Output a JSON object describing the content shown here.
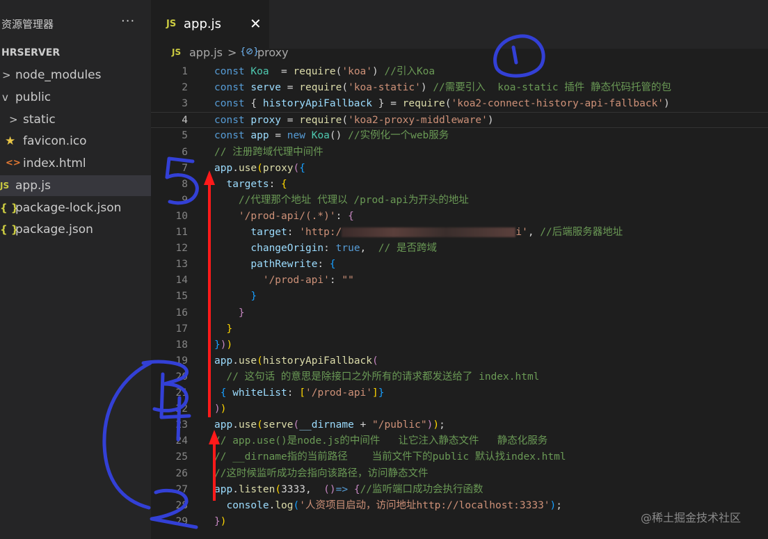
{
  "sidebar": {
    "title": "资源管理器",
    "more": "···",
    "section": "HRSERVER",
    "items": [
      {
        "label": "node_modules",
        "icon": "chevron-right-icon"
      },
      {
        "label": "public",
        "icon": "chevron-down-icon"
      },
      {
        "label": "static",
        "icon": "chevron-right-icon"
      },
      {
        "label": "favicon.ico",
        "icon": "star-icon"
      },
      {
        "label": "index.html",
        "icon": "html-icon"
      },
      {
        "label": "app.js",
        "icon": "js-icon"
      },
      {
        "label": "package-lock.json",
        "icon": "json-icon"
      },
      {
        "label": "package.json",
        "icon": "json-icon"
      }
    ]
  },
  "tab": {
    "badge": "JS",
    "label": "app.js",
    "close": "✕"
  },
  "breadcrumb": {
    "badge": "JS",
    "file": "app.js",
    "sep": ">",
    "symbol_icon": "{⊘}",
    "symbol": "proxy"
  },
  "editor": {
    "line_numbers": [
      "1",
      "2",
      "3",
      "4",
      "5",
      "6",
      "7",
      "8",
      "9",
      "10",
      "11",
      "12",
      "13",
      "14",
      "15",
      "16",
      "17",
      "18",
      "19",
      "20",
      "21",
      "22",
      "23",
      "24",
      "25",
      "26",
      "27",
      "28",
      "29"
    ],
    "code": [
      [
        {
          "t": "kw",
          "v": "const "
        },
        {
          "t": "cl",
          "v": "Koa"
        },
        {
          "t": "plain",
          "v": "  = "
        },
        {
          "t": "fn",
          "v": "require"
        },
        {
          "t": "plain",
          "v": "("
        },
        {
          "t": "st",
          "v": "'koa'"
        },
        {
          "t": "plain",
          "v": ") "
        },
        {
          "t": "cm",
          "v": "//引入Koa"
        }
      ],
      [
        {
          "t": "kw",
          "v": "const "
        },
        {
          "t": "vr",
          "v": "serve"
        },
        {
          "t": "plain",
          "v": " = "
        },
        {
          "t": "fn",
          "v": "require"
        },
        {
          "t": "plain",
          "v": "("
        },
        {
          "t": "st",
          "v": "'koa-static'"
        },
        {
          "t": "plain",
          "v": ") "
        },
        {
          "t": "cm",
          "v": "//需要引入  koa-static 插件 静态代码托管的包"
        }
      ],
      [
        {
          "t": "kw",
          "v": "const "
        },
        {
          "t": "plain",
          "v": "{ "
        },
        {
          "t": "vr",
          "v": "historyApiFallback"
        },
        {
          "t": "plain",
          "v": " } = "
        },
        {
          "t": "fn",
          "v": "require"
        },
        {
          "t": "plain",
          "v": "("
        },
        {
          "t": "st",
          "v": "'koa2-connect-history-api-fallback'"
        },
        {
          "t": "plain",
          "v": ")"
        }
      ],
      [
        {
          "t": "kw",
          "v": "const "
        },
        {
          "t": "vr",
          "v": "proxy"
        },
        {
          "t": "plain",
          "v": " = "
        },
        {
          "t": "fn",
          "v": "require"
        },
        {
          "t": "plain",
          "v": "("
        },
        {
          "t": "st",
          "v": "'koa2-proxy-middleware'"
        },
        {
          "t": "plain",
          "v": ")"
        }
      ],
      [
        {
          "t": "kw",
          "v": "const "
        },
        {
          "t": "vr",
          "v": "app"
        },
        {
          "t": "plain",
          "v": " = "
        },
        {
          "t": "kw",
          "v": "new "
        },
        {
          "t": "cl",
          "v": "Koa"
        },
        {
          "t": "plain",
          "v": "() "
        },
        {
          "t": "cm",
          "v": "//实例化一个web服务"
        }
      ],
      [
        {
          "t": "cm",
          "v": "// 注册跨域代理中间件"
        }
      ],
      [
        {
          "t": "vr",
          "v": "app"
        },
        {
          "t": "plain",
          "v": "."
        },
        {
          "t": "fn",
          "v": "use"
        },
        {
          "t": "py",
          "v": "("
        },
        {
          "t": "fn",
          "v": "proxy"
        },
        {
          "t": "pk",
          "v": "("
        },
        {
          "t": "pb",
          "v": "{"
        }
      ],
      [
        {
          "t": "plain",
          "v": "  "
        },
        {
          "t": "vr",
          "v": "targets"
        },
        {
          "t": "plain",
          "v": ": "
        },
        {
          "t": "py",
          "v": "{"
        }
      ],
      [
        {
          "t": "plain",
          "v": "    "
        },
        {
          "t": "cm",
          "v": "//代理那个地址 代理以 /prod-api为开头的地址"
        }
      ],
      [
        {
          "t": "plain",
          "v": "    "
        },
        {
          "t": "st",
          "v": "'/prod-api/(.*)'"
        },
        {
          "t": "plain",
          "v": ": "
        },
        {
          "t": "pk",
          "v": "{"
        }
      ],
      [
        {
          "t": "plain",
          "v": "      "
        },
        {
          "t": "vr",
          "v": "target"
        },
        {
          "t": "plain",
          "v": ": "
        },
        {
          "t": "st",
          "v": "'http:/"
        },
        {
          "t": "blur",
          "v": ""
        },
        {
          "t": "st",
          "v": "i'"
        },
        {
          "t": "plain",
          "v": ", "
        },
        {
          "t": "cm",
          "v": "//后端服务器地址"
        }
      ],
      [
        {
          "t": "plain",
          "v": "      "
        },
        {
          "t": "vr",
          "v": "changeOrigin"
        },
        {
          "t": "plain",
          "v": ": "
        },
        {
          "t": "kw",
          "v": "true"
        },
        {
          "t": "plain",
          "v": ",  "
        },
        {
          "t": "cm",
          "v": "// 是否跨域"
        }
      ],
      [
        {
          "t": "plain",
          "v": "      "
        },
        {
          "t": "vr",
          "v": "pathRewrite"
        },
        {
          "t": "plain",
          "v": ": "
        },
        {
          "t": "pb",
          "v": "{"
        }
      ],
      [
        {
          "t": "plain",
          "v": "        "
        },
        {
          "t": "st",
          "v": "'/prod-api'"
        },
        {
          "t": "plain",
          "v": ": "
        },
        {
          "t": "st",
          "v": "\"\""
        }
      ],
      [
        {
          "t": "plain",
          "v": "      "
        },
        {
          "t": "pb",
          "v": "}"
        }
      ],
      [
        {
          "t": "plain",
          "v": "    "
        },
        {
          "t": "pk",
          "v": "}"
        }
      ],
      [
        {
          "t": "plain",
          "v": "  "
        },
        {
          "t": "py",
          "v": "}"
        }
      ],
      [
        {
          "t": "pb",
          "v": "}"
        },
        {
          "t": "pk",
          "v": ")"
        },
        {
          "t": "py",
          "v": ")"
        }
      ],
      [
        {
          "t": "vr",
          "v": "app"
        },
        {
          "t": "plain",
          "v": "."
        },
        {
          "t": "fn",
          "v": "use"
        },
        {
          "t": "py",
          "v": "("
        },
        {
          "t": "fn",
          "v": "historyApiFallback"
        },
        {
          "t": "pk",
          "v": "("
        }
      ],
      [
        {
          "t": "plain",
          "v": "  "
        },
        {
          "t": "cm",
          "v": "// 这句话 的意思是除接口之外所有的请求都发送给了 index.html"
        }
      ],
      [
        {
          "t": "plain",
          "v": " "
        },
        {
          "t": "pb",
          "v": "{ "
        },
        {
          "t": "vr",
          "v": "whiteList"
        },
        {
          "t": "plain",
          "v": ": "
        },
        {
          "t": "py",
          "v": "["
        },
        {
          "t": "st",
          "v": "'/prod-api'"
        },
        {
          "t": "py",
          "v": "]"
        },
        {
          "t": "pb",
          "v": "}"
        }
      ],
      [
        {
          "t": "pk",
          "v": ")"
        },
        {
          "t": "py",
          "v": ")"
        }
      ],
      [
        {
          "t": "vr",
          "v": "app"
        },
        {
          "t": "plain",
          "v": "."
        },
        {
          "t": "fn",
          "v": "use"
        },
        {
          "t": "py",
          "v": "("
        },
        {
          "t": "fn",
          "v": "serve"
        },
        {
          "t": "pk",
          "v": "("
        },
        {
          "t": "vr",
          "v": "__dirname"
        },
        {
          "t": "plain",
          "v": " + "
        },
        {
          "t": "st",
          "v": "\"/public\""
        },
        {
          "t": "pk",
          "v": ")"
        },
        {
          "t": "py",
          "v": ")"
        },
        {
          "t": "plain",
          "v": ";"
        }
      ],
      [
        {
          "t": "cm",
          "v": "// app.use()是node.js的中间件   让它注入静态文件   静态化服务"
        }
      ],
      [
        {
          "t": "cm",
          "v": "// __dirname指的当前路径    当前文件下的public 默认找index.html"
        }
      ],
      [
        {
          "t": "cm",
          "v": "//这时候监听成功会指向该路径，访问静态文件"
        }
      ],
      [
        {
          "t": "vr",
          "v": "app"
        },
        {
          "t": "plain",
          "v": "."
        },
        {
          "t": "fn",
          "v": "listen"
        },
        {
          "t": "py",
          "v": "("
        },
        {
          "t": "plain",
          "v": "3333,  "
        },
        {
          "t": "pk",
          "v": "()"
        },
        {
          "t": "kw",
          "v": "=> "
        },
        {
          "t": "pk",
          "v": "{"
        },
        {
          "t": "cm",
          "v": "//监听端口成功会执行函数"
        }
      ],
      [
        {
          "t": "plain",
          "v": "  "
        },
        {
          "t": "vr",
          "v": "console"
        },
        {
          "t": "plain",
          "v": "."
        },
        {
          "t": "fn",
          "v": "log"
        },
        {
          "t": "pb",
          "v": "("
        },
        {
          "t": "st",
          "v": "'人资项目启动，访问地址http://localhost:3333'"
        },
        {
          "t": "pb",
          "v": ")"
        },
        {
          "t": "plain",
          "v": ";"
        }
      ],
      [
        {
          "t": "pk",
          "v": "}"
        },
        {
          "t": "py",
          "v": ")"
        }
      ]
    ]
  },
  "annotations": {
    "one": "1",
    "two": "2",
    "three": "3",
    "four": "4",
    "five": "5"
  },
  "watermark": "@稀土掘金技术社区",
  "colors": {
    "accent_arrow": "#ff1a1a",
    "pen": "#3340d6"
  }
}
